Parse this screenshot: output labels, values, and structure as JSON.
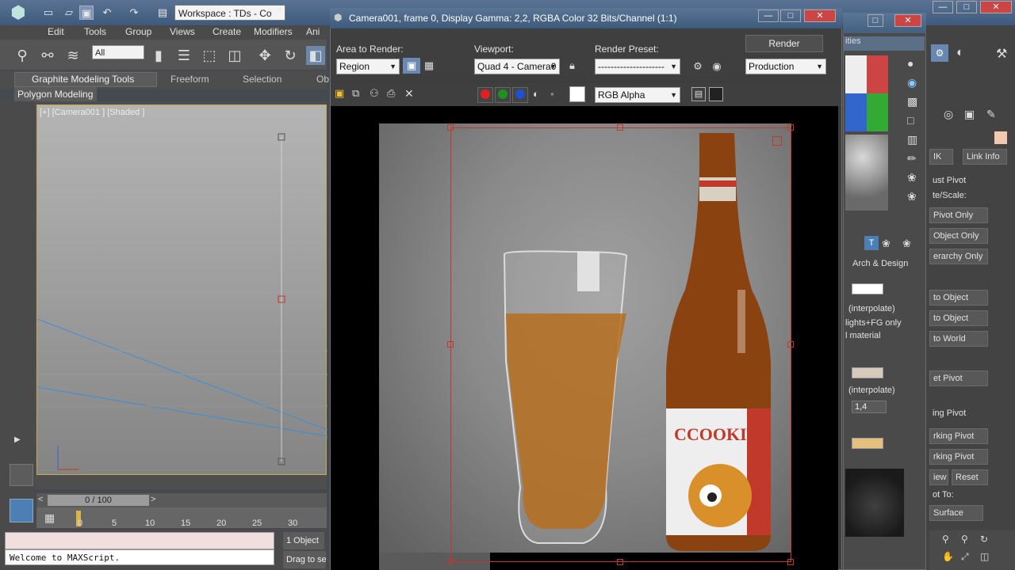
{
  "toolbar": {
    "workspace": "Workspace : TDs - Co",
    "selection_filter": "All"
  },
  "menu": [
    "Edit",
    "Tools",
    "Group",
    "Views",
    "Create",
    "Modifiers",
    "Ani"
  ],
  "ribbon": {
    "tabs": [
      "Graphite Modeling Tools",
      "Freeform",
      "Selection",
      "Ob"
    ],
    "panel": "Polygon Modeling"
  },
  "viewport": {
    "label": "[+] [Camera001 ] [Shaded ]"
  },
  "timeline": {
    "position": "0 / 100",
    "ticks": [
      "0",
      "5",
      "10",
      "15",
      "20",
      "25",
      "30"
    ]
  },
  "status": {
    "maxscript_text": "Welcome to MAXScript.",
    "selection_count": "1 Object",
    "hint": "Drag to select"
  },
  "render_window": {
    "title": "Camera001, frame 0, Display Gamma: 2,2, RGBA Color 32 Bits/Channel (1:1)",
    "area_label": "Area to Render:",
    "area_value": "Region",
    "viewport_label": "Viewport:",
    "viewport_value": "Quad 4 - Camera0",
    "preset_label": "Render Preset:",
    "preset_value": "---------------------",
    "render_button": "Render",
    "mode_value": "Production",
    "channel_value": "RGB Alpha"
  },
  "command_panel": {
    "tab_ik": "IK",
    "tab_link": "Link Info",
    "pivot_header": "ust Pivot",
    "move_rotate_scale": "te/Scale:",
    "btn_pivot_only": "Pivot Only",
    "btn_object_only": "Object Only",
    "btn_hierarchy_only": "erarchy Only",
    "btn_to_object": "to Object",
    "btn_to_object2": "to Object",
    "btn_to_world": "to World",
    "btn_reset_pivot": "et Pivot",
    "working_pivot": "ing Pivot",
    "btn_edit_working": "rking Pivot",
    "btn_use_working": "rking Pivot",
    "btn_view": "iew",
    "btn_reset": "Reset",
    "align_to": "ot To:",
    "btn_surface": "Surface"
  },
  "material_editor": {
    "subtitle": "ities",
    "arch_design": "Arch & Design",
    "interp1": "(interpolate)",
    "fg_only": "lights+FG only",
    "material": "l material",
    "interp2": "(interpolate)",
    "spinner_value": "1,4"
  },
  "colors": {
    "title_blue": "#4a6688",
    "region_red": "#c0392b",
    "viewport_border": "#c8a64a"
  }
}
